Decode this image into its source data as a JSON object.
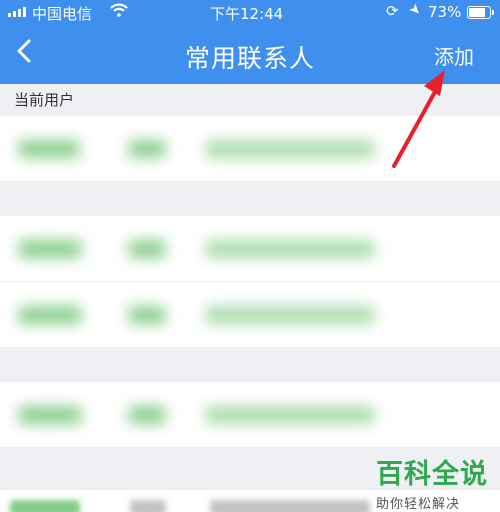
{
  "status_bar": {
    "carrier": "中国电信",
    "wifi_icon": "wifi-icon",
    "time": "下午12:44",
    "rotation_lock_icon": "rotation-lock-icon",
    "location_icon": "location-arrow-icon",
    "battery_percent": "73%",
    "battery_level": 0.73
  },
  "nav": {
    "back_icon": "chevron-left-icon",
    "back_glyph": "<",
    "title": "常用联系人",
    "add_label": "添加"
  },
  "sections": {
    "current_user": "当前用户",
    "blurred_section_1": "",
    "blurred_section_2": "",
    "blurred_section_3": ""
  },
  "contacts": [
    {
      "name": "",
      "type": "",
      "id_number": ""
    },
    {
      "name": "",
      "type": "",
      "id_number": ""
    },
    {
      "name": "",
      "type": "",
      "id_number": ""
    },
    {
      "name": "",
      "type": "",
      "id_number": ""
    }
  ],
  "watermark": {
    "title": "百科全说",
    "subtitle": "助你轻松解决"
  },
  "colors": {
    "nav_blue": "#3e8fee",
    "annotation_red": "#e8202a",
    "watermark_green": "#2fa84f"
  }
}
